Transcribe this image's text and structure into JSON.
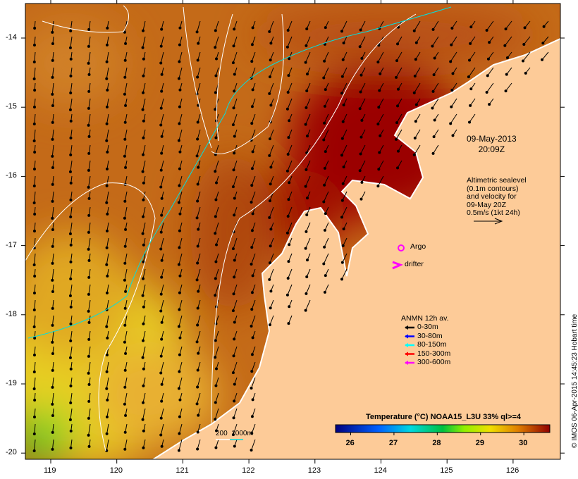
{
  "title": {
    "date": "09-May-2013",
    "time": "20:09Z"
  },
  "velocity_note": [
    "Altimetric sealevel",
    "(0.1m contours)",
    "and velocity for",
    "09-May 20Z",
    "0.5m/s (1kt 24h)"
  ],
  "markers": {
    "argo": "Argo",
    "drifter": "drifter",
    "argo_color": "#ff00ff"
  },
  "anmn": {
    "title": "ANMN 12h av.",
    "items": [
      {
        "label": "0-30m",
        "color": "#000000"
      },
      {
        "label": "30-80m",
        "color": "#0000ff"
      },
      {
        "label": "80-150m",
        "color": "#00ffff"
      },
      {
        "label": "150-300m",
        "color": "#ff0000"
      },
      {
        "label": "300-600m",
        "color": "#ff00ff"
      }
    ]
  },
  "bathy_scale": {
    "a": "200",
    "b": "1000m"
  },
  "colorbar": {
    "title": "Temperature (°C) NOAA15_L3U 33% ql>=4",
    "ticks": [
      "26",
      "27",
      "28",
      "29",
      "30"
    ],
    "range": [
      25.65,
      30.6
    ]
  },
  "lon_ticks": [
    "119",
    "120",
    "121",
    "122",
    "123",
    "124",
    "125",
    "126"
  ],
  "lat_ticks": [
    "-14",
    "-15",
    "-16",
    "-17",
    "-18",
    "-19",
    "-20"
  ],
  "credit": "© IMOS 06-Apr-2015 14:45:23 Hobart time",
  "colors": {
    "land": "#fdcb98",
    "hot": "#9b0000"
  }
}
